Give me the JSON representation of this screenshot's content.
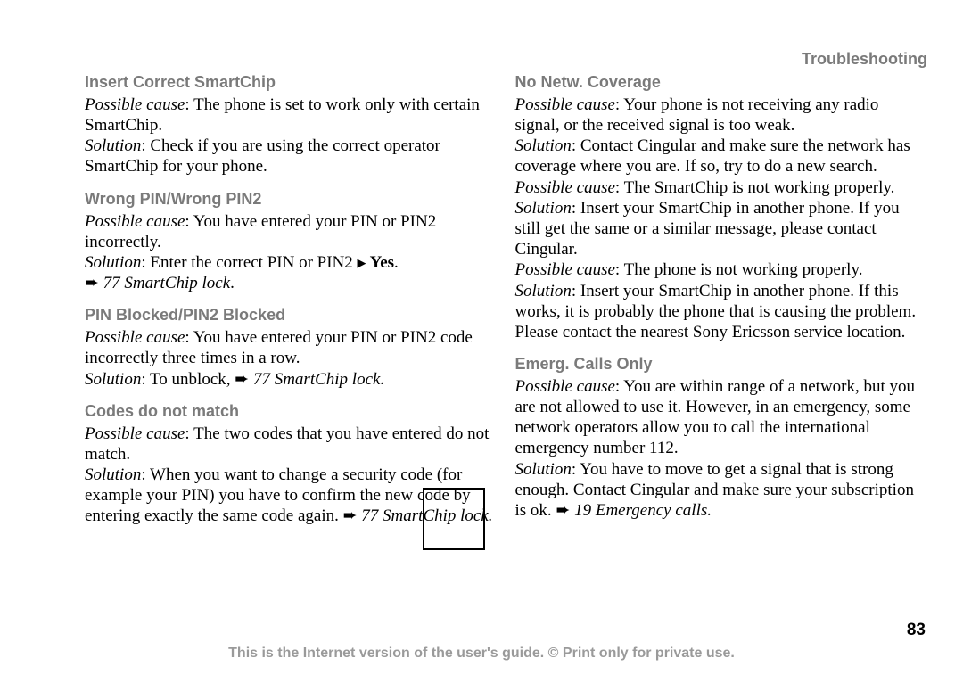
{
  "header": {
    "title": "Troubleshooting"
  },
  "left": {
    "sec1": {
      "title": "Insert Correct SmartChip",
      "cause_label": "Possible cause",
      "cause_text": ": The phone is set to work only with certain SmartChip.",
      "sol_label": "Solution",
      "sol_text": ": Check if you are using the correct operator SmartChip for your phone."
    },
    "sec2": {
      "title": "Wrong PIN/Wrong PIN2",
      "cause_label": "Possible cause",
      "cause_text": ": You have entered your PIN or PIN2 incorrectly.",
      "sol_label": "Solution",
      "sol_text1": ": Enter the correct PIN or PIN2 ",
      "sol_yes": " Yes",
      "sol_text2": ".",
      "ref": " 77 SmartChip lock"
    },
    "sec3": {
      "title": "PIN Blocked/PIN2 Blocked",
      "cause_label": "Possible cause",
      "cause_text": ": You have entered your PIN or PIN2 code incorrectly three times in a row.",
      "sol_label": "Solution",
      "sol_text": ": To unblock, ",
      "ref": " 77 SmartChip lock."
    },
    "sec4": {
      "title": "Codes do not match",
      "cause_label": "Possible cause",
      "cause_text": ": The two codes that you have entered do not match.",
      "sol_label": "Solution",
      "sol_text": ": When you want to change a security code (for example your PIN) you have to confirm the new code by entering exactly the same code again. ",
      "ref": " 77 SmartChip lock."
    }
  },
  "right": {
    "sec1": {
      "title": "No Netw. Coverage",
      "c1_label": "Possible cause",
      "c1_text": ": Your phone is not receiving any radio signal, or the received signal is too weak.",
      "s1_label": "Solution",
      "s1_text": ": Contact Cingular and make sure the network has coverage where you are. If so, try to do a new search.",
      "c2_label": "Possible cause",
      "c2_text": ": The SmartChip is not working properly.",
      "s2_label": "Solution",
      "s2_text": ": Insert your SmartChip in another phone. If you still get the same or a similar message, please contact Cingular.",
      "c3_label": "Possible cause",
      "c3_text": ": The phone is not working properly.",
      "s3_label": "Solution",
      "s3_text": ": Insert your SmartChip in another phone. If this works, it is probably the phone that is causing the problem. Please contact the nearest Sony Ericsson service location."
    },
    "sec2": {
      "title": "Emerg. Calls Only",
      "cause_label": "Possible cause",
      "cause_text": ": You are within range of a network, but you are not allowed to use it. However, in an emergency, some network operators allow you to call the international emergency number 112.",
      "sol_label": "Solution",
      "sol_text": ": You have to move to get a signal that is strong enough. Contact Cingular and make sure your subscription is ok. ",
      "ref": " 19 Emergency calls."
    }
  },
  "page_number": "83",
  "footer": "This is the Internet version of the user's guide. © Print only for private use."
}
